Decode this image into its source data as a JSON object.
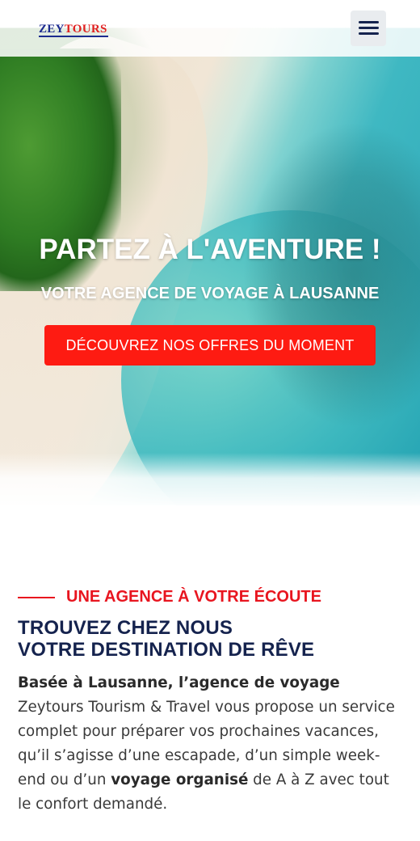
{
  "header": {
    "logo_part1": "ZEY",
    "logo_part2": "TOURS",
    "menu_icon": "hamburger-menu-icon"
  },
  "hero": {
    "title": "PARTEZ À L'AVENTURE !",
    "subtitle": "VOTRE AGENCE DE VOYAGE À LAUSANNE",
    "cta_label": "DÉCOUVREZ NOS OFFRES DU MOMENT"
  },
  "about": {
    "eyebrow": "UNE AGENCE À VOTRE ÉCOUTE",
    "heading_line1": "TROUVEZ CHEZ NOUS",
    "heading_line2": "VOTRE DESTINATION DE RÊVE",
    "paragraph": {
      "bold1": "Basée à Lausanne, l’agence de voyage",
      "text1": " Zeytours Tourism & Travel vous propose un service complet pour préparer vos prochaines vacances, qu’il s’agisse d’une escapade, d’un simple week-end ou d’un ",
      "bold2": "voyage organisé",
      "text2": " de A à Z avec tout le confort demandé."
    }
  },
  "colors": {
    "brand_blue": "#1c2b8f",
    "brand_red": "#e02020",
    "navy": "#15234e",
    "cta_red": "#fe1b12",
    "accent_red": "#e8151f"
  }
}
